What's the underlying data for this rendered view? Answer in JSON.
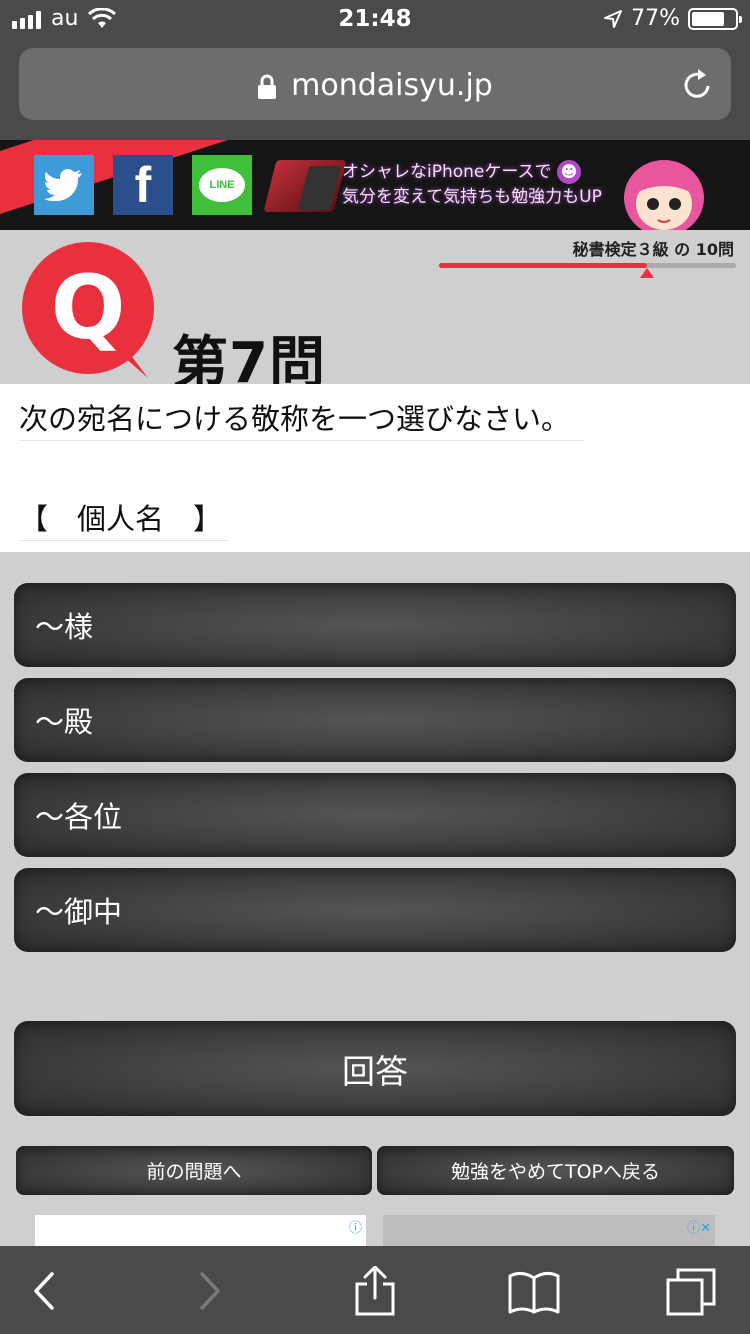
{
  "status": {
    "carrier": "au",
    "time": "21:48",
    "battery": "77%",
    "battery_level": 0.77
  },
  "browser": {
    "url": "mondaisyu.jp"
  },
  "banner": {
    "line_label": "LINE",
    "ad_line1": "オシャレなiPhoneケースで",
    "ad_line2": "気分を変えて気持ちも勉強力もUP",
    "twitter_icon": "twitter-icon",
    "facebook_icon": "facebook-icon",
    "facebook_glyph": "f"
  },
  "quiz": {
    "progress_label": "秘書検定３級 の 10問",
    "progress": 0.7,
    "q_mark": "Q",
    "title": "第7問",
    "question": "次の宛名につける敬称を一つ選びなさい。",
    "subject": "【　個人名　】",
    "options": [
      "～様",
      "～殿",
      "～各位",
      "～御中"
    ],
    "answer_label": "回答",
    "prev_label": "前の問題へ",
    "top_label": "勉強をやめてTOPへ戻る"
  },
  "ads": {
    "info_left": "ⓘ",
    "info_right": "ⓘ✕"
  },
  "colors": {
    "accent": "#e8303f",
    "toolbar": "#4a4a4a",
    "button": "#3f3f3f"
  }
}
